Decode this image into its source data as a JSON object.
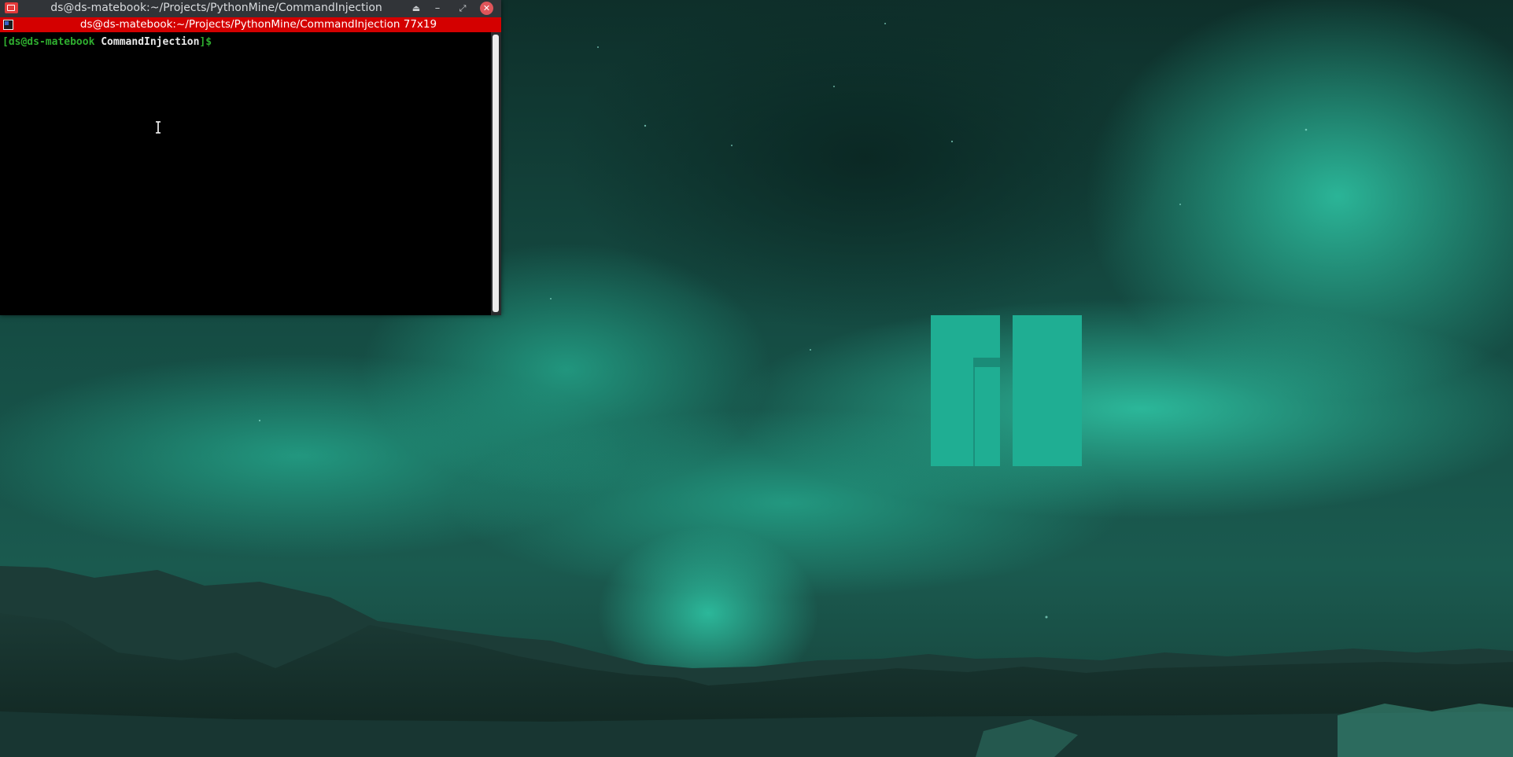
{
  "window": {
    "title": "ds@ds-matebook:~/Projects/PythonMine/CommandInjection",
    "buttons": {
      "shade": "⏏",
      "minimize": "–",
      "maximize": "⤢",
      "close": "✕"
    }
  },
  "tab": {
    "title": "ds@ds-matebook:~/Projects/PythonMine/CommandInjection 77x19"
  },
  "terminal": {
    "prompt_open": "[",
    "prompt_user_host": "ds@ds-matebook",
    "prompt_dir": "CommandInjection",
    "prompt_close": "]$"
  },
  "colors": {
    "tab_bar": "#d40000",
    "titlebar": "#313438",
    "prompt_green": "#2fae2f",
    "wallpaper_accent": "#1fae93",
    "close_button": "#e0555a"
  },
  "icons": {
    "app": "terminal-app-icon",
    "tab": "terminal-tab-icon",
    "wallpaper_logo": "manjaro-logo"
  }
}
